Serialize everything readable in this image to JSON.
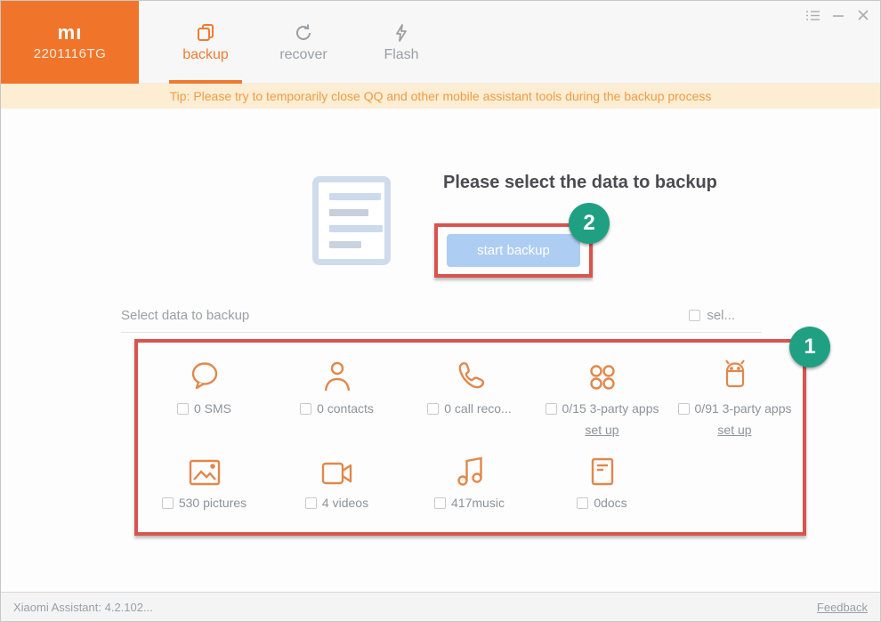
{
  "window": {
    "brand": "mı",
    "device_model": "2201116TG",
    "controls": {
      "menu_icon": "menu-list-icon",
      "minimize_icon": "minimize-icon",
      "close_icon": "close-icon"
    }
  },
  "tabs": [
    {
      "label": "backup",
      "icon": "backup-copy-icon",
      "active": true
    },
    {
      "label": "recover",
      "icon": "recover-refresh-icon",
      "active": false
    },
    {
      "label": "Flash",
      "icon": "flash-lightning-icon",
      "active": false
    }
  ],
  "tip": "Tip: Please try to temporarily close QQ and other mobile assistant tools during the backup process",
  "main": {
    "title": "Please select the data to backup",
    "start_button_label": "start backup",
    "select_label": "Select data to backup",
    "select_all_label": "sel...",
    "annotation_badge_1": "1",
    "annotation_badge_2": "2"
  },
  "items": [
    {
      "icon": "sms-icon",
      "label": "0 SMS"
    },
    {
      "icon": "contacts-icon",
      "label": "0 contacts"
    },
    {
      "icon": "call-records-icon",
      "label": "0 call reco..."
    },
    {
      "icon": "third-party-apps-icon",
      "label": "0/15 3-party apps",
      "link": "set up"
    },
    {
      "icon": "android-apps-icon",
      "label": "0/91 3-party apps",
      "link": "set up"
    },
    {
      "icon": "pictures-icon",
      "label": "530 pictures"
    },
    {
      "icon": "videos-icon",
      "label": "4 videos"
    },
    {
      "icon": "music-icon",
      "label": "417music"
    },
    {
      "icon": "docs-icon",
      "label": "0docs"
    }
  ],
  "footer": {
    "version": "Xiaomi Assistant: 4.2.102...",
    "feedback": "Feedback"
  },
  "colors": {
    "accent_orange": "#f0742a",
    "icon_orange": "#e0884d",
    "tip_bg": "#fcedd3",
    "tip_text": "#f09c45",
    "annotation_red": "#d9534f",
    "badge_green": "#1fa083",
    "button_blue": "#aecdf2",
    "label_gray": "#8d939a"
  }
}
